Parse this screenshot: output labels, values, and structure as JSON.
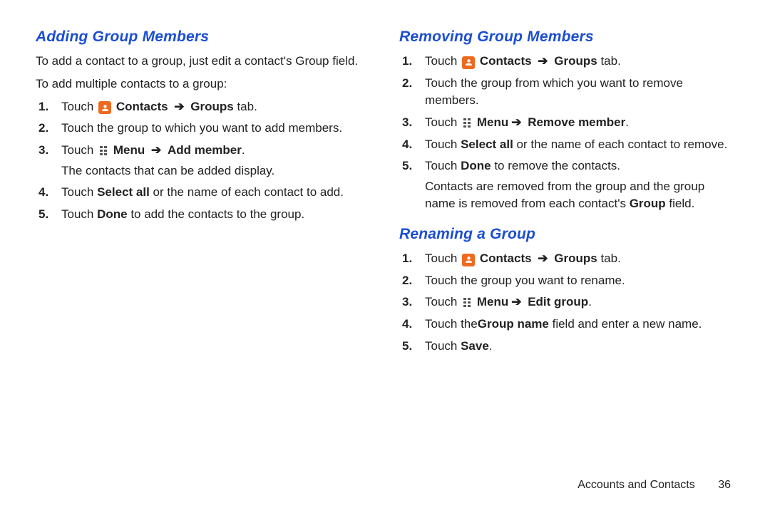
{
  "footer": {
    "section": "Accounts and Contacts",
    "page": "36"
  },
  "sec1": {
    "heading": "Adding Group Members",
    "intro1": "To add a contact to a group, just edit a contact's Group field.",
    "intro2": "To add multiple contacts to a group:",
    "steps": [
      {
        "n": "1",
        "pre": "Touch ",
        "boldA": "Contacts",
        "arrow": "➔",
        "boldB": "Groups ",
        "post": "tab.",
        "icon": "contacts"
      },
      {
        "n": "2",
        "pre": "Touch the group to which you want to add members."
      },
      {
        "n": "3",
        "pre": "Touch ",
        "boldA": "Menu",
        "arrow": "➔",
        "boldB": "Add member",
        "post": ".",
        "icon": "menu",
        "sub": "The contacts that can be added display."
      },
      {
        "n": "4",
        "pre": "Touch ",
        "boldA": "Select all",
        "mid": " or the name of each contact to add."
      },
      {
        "n": "5",
        "pre": "Touch ",
        "boldA": "Done",
        "mid": " to add the contacts to the group."
      }
    ]
  },
  "sec2": {
    "heading": "Removing Group Members",
    "steps": [
      {
        "n": "1",
        "pre": "Touch ",
        "boldA": "Contacts",
        "arrow": "➔",
        "boldB": "Groups ",
        "post": "tab.",
        "icon": "contacts"
      },
      {
        "n": "2",
        "pre": "Touch the group from which you want to remove members."
      },
      {
        "n": "3",
        "pre": "Touch ",
        "boldA": "Menu",
        "arrow": "➔",
        "boldSp": " ",
        "boldB": "Remove member",
        "post": ".",
        "icon": "menu"
      },
      {
        "n": "4",
        "pre": "Touch ",
        "boldA": "Select all",
        "mid": " or the name of each contact to remove."
      },
      {
        "n": "5",
        "pre": "Touch ",
        "boldA": "Done",
        "mid": " to remove the contacts.",
        "sub": "Contacts are removed from the group and the group name is removed from each contact's ",
        "subBold": "Group",
        "subPost": " field."
      }
    ]
  },
  "sec3": {
    "heading": "Renaming a Group",
    "steps": [
      {
        "n": "1",
        "pre": "Touch ",
        "boldA": "Contacts",
        "arrow": "➔",
        "boldB": "Groups ",
        "post": "tab.",
        "icon": "contacts"
      },
      {
        "n": "2",
        "pre": "Touch the group you want to rename."
      },
      {
        "n": "3",
        "pre": "Touch ",
        "boldA": "Menu",
        "arrow": "➔",
        "boldSp": " ",
        "boldB": "Edit group",
        "post": ".",
        "icon": "menu"
      },
      {
        "n": "4",
        "pre": "Touch the",
        "boldA": "Group name ",
        "mid": " field and enter a new name."
      },
      {
        "n": "5",
        "pre": "Touch ",
        "boldA": "Save",
        "post": "."
      }
    ]
  }
}
